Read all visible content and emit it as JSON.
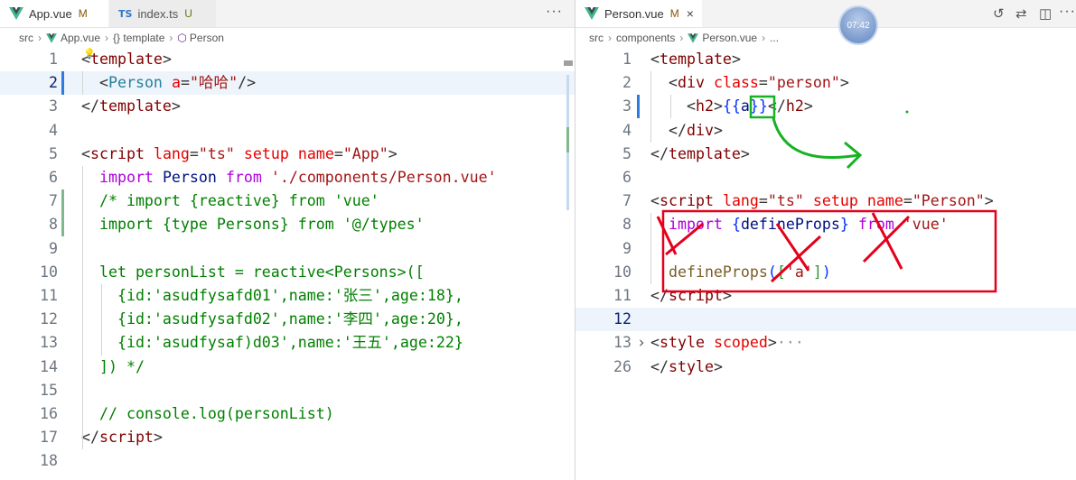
{
  "colors": {
    "accent": "#005fb8",
    "vue_green": "#41b883",
    "annotation_red": "#e4001b",
    "annotation_green": "#17b224"
  },
  "left": {
    "tabs": [
      {
        "label": "App.vue",
        "badge": "M",
        "icon": "vue-icon"
      },
      {
        "label": "index.ts",
        "badge": "U",
        "icon": "ts-icon"
      }
    ],
    "ts_icon_text": "TS",
    "more": "···",
    "breadcrumb": {
      "folder": "src",
      "file": "App.vue",
      "node": "{} template",
      "component": "Person"
    },
    "lines": [
      {
        "n": "1",
        "tokens": [
          [
            "p",
            "<"
          ],
          [
            "t",
            "template"
          ],
          [
            "p",
            ">"
          ]
        ]
      },
      {
        "n": "2",
        "tokens": [
          [
            "p",
            "  <"
          ],
          [
            "ty",
            "Person"
          ],
          [
            "p",
            " "
          ],
          [
            "a",
            "a"
          ],
          [
            "p",
            "="
          ],
          [
            "s",
            "\"哈哈\""
          ],
          [
            "p",
            "/>"
          ]
        ]
      },
      {
        "n": "3",
        "tokens": [
          [
            "p",
            "</"
          ],
          [
            "t",
            "template"
          ],
          [
            "p",
            ">"
          ]
        ]
      },
      {
        "n": "4",
        "tokens": []
      },
      {
        "n": "5",
        "tokens": [
          [
            "p",
            "<"
          ],
          [
            "t",
            "script"
          ],
          [
            "p",
            " "
          ],
          [
            "a",
            "lang"
          ],
          [
            "p",
            "="
          ],
          [
            "s",
            "\"ts\""
          ],
          [
            "p",
            " "
          ],
          [
            "a",
            "setup"
          ],
          [
            "p",
            " "
          ],
          [
            "a",
            "name"
          ],
          [
            "p",
            "="
          ],
          [
            "s",
            "\"App\""
          ],
          [
            "p",
            ">"
          ]
        ]
      },
      {
        "n": "6",
        "tokens": [
          [
            "p",
            "  "
          ],
          [
            "kw",
            "import"
          ],
          [
            "p",
            " "
          ],
          [
            "v",
            "Person"
          ],
          [
            "p",
            " "
          ],
          [
            "kw",
            "from"
          ],
          [
            "p",
            " "
          ],
          [
            "s",
            "'./components/Person.vue'"
          ]
        ]
      },
      {
        "n": "7",
        "tokens": [
          [
            "c",
            "  /* import {reactive} from 'vue'"
          ]
        ]
      },
      {
        "n": "8",
        "tokens": [
          [
            "c",
            "  import {type Persons} from '@/types'"
          ]
        ]
      },
      {
        "n": "9",
        "tokens": []
      },
      {
        "n": "10",
        "tokens": [
          [
            "c",
            "  let personList = reactive<Persons>(["
          ]
        ]
      },
      {
        "n": "11",
        "tokens": [
          [
            "c",
            "    {id:'asudfysafd01',name:'张三',age:18},"
          ]
        ]
      },
      {
        "n": "12",
        "tokens": [
          [
            "c",
            "    {id:'asudfysafd02',name:'李四',age:20},"
          ]
        ]
      },
      {
        "n": "13",
        "tokens": [
          [
            "c",
            "    {id:'asudfysaf)d03',name:'王五',age:22}"
          ]
        ]
      },
      {
        "n": "14",
        "tokens": [
          [
            "c",
            "  ]) */"
          ]
        ]
      },
      {
        "n": "15",
        "tokens": []
      },
      {
        "n": "16",
        "tokens": [
          [
            "c",
            "  // console.log(personList)"
          ]
        ]
      },
      {
        "n": "17",
        "tokens": [
          [
            "p",
            "</"
          ],
          [
            "t",
            "script"
          ],
          [
            "p",
            ">"
          ]
        ]
      },
      {
        "n": "18",
        "tokens": []
      }
    ]
  },
  "right": {
    "tabs": [
      {
        "label": "Person.vue",
        "badge": "M",
        "icon": "vue-icon",
        "close": "×"
      }
    ],
    "timer": "07:42",
    "breadcrumb": {
      "folder": "src",
      "subfolder": "components",
      "file": "Person.vue",
      "rest": "..."
    },
    "lines": [
      {
        "n": "1",
        "tokens": [
          [
            "p",
            "<"
          ],
          [
            "t",
            "template"
          ],
          [
            "p",
            ">"
          ]
        ]
      },
      {
        "n": "2",
        "tokens": [
          [
            "p",
            "  <"
          ],
          [
            "t",
            "div"
          ],
          [
            "p",
            " "
          ],
          [
            "a",
            "class"
          ],
          [
            "p",
            "="
          ],
          [
            "s",
            "\"person\""
          ],
          [
            "p",
            ">"
          ]
        ]
      },
      {
        "n": "3",
        "tokens": [
          [
            "p",
            "    <"
          ],
          [
            "t",
            "h2"
          ],
          [
            "p",
            ">"
          ],
          [
            "br",
            "{{"
          ],
          [
            "v",
            "a"
          ],
          [
            "br",
            "}}"
          ],
          [
            "p",
            "</"
          ],
          [
            "t",
            "h2"
          ],
          [
            "p",
            ">"
          ]
        ]
      },
      {
        "n": "4",
        "tokens": [
          [
            "p",
            "  </"
          ],
          [
            "t",
            "div"
          ],
          [
            "p",
            ">"
          ]
        ]
      },
      {
        "n": "5",
        "tokens": [
          [
            "p",
            "</"
          ],
          [
            "t",
            "template"
          ],
          [
            "p",
            ">"
          ]
        ]
      },
      {
        "n": "6",
        "tokens": []
      },
      {
        "n": "7",
        "tokens": [
          [
            "p",
            "<"
          ],
          [
            "t",
            "script"
          ],
          [
            "p",
            " "
          ],
          [
            "a",
            "lang"
          ],
          [
            "p",
            "="
          ],
          [
            "s",
            "\"ts\""
          ],
          [
            "p",
            " "
          ],
          [
            "a",
            "setup"
          ],
          [
            "p",
            " "
          ],
          [
            "a",
            "name"
          ],
          [
            "p",
            "="
          ],
          [
            "s",
            "\"Person\""
          ],
          [
            "p",
            ">"
          ]
        ]
      },
      {
        "n": "8",
        "tokens": [
          [
            "p",
            "  "
          ],
          [
            "kw",
            "import"
          ],
          [
            "p",
            " "
          ],
          [
            "br",
            "{"
          ],
          [
            "v",
            "defineProps"
          ],
          [
            "br",
            "}"
          ],
          [
            "p",
            " "
          ],
          [
            "kw",
            "from"
          ],
          [
            "p",
            " "
          ],
          [
            "s",
            "'vue'"
          ]
        ]
      },
      {
        "n": "9",
        "tokens": []
      },
      {
        "n": "10",
        "tokens": [
          [
            "p",
            "  "
          ],
          [
            "f",
            "defineProps"
          ],
          [
            "br",
            "("
          ],
          [
            "br2",
            "["
          ],
          [
            "s",
            "'a'"
          ],
          [
            "br2",
            "]"
          ],
          [
            "br",
            ")"
          ]
        ]
      },
      {
        "n": "11",
        "tokens": [
          [
            "p",
            "</"
          ],
          [
            "t",
            "script"
          ],
          [
            "p",
            ">"
          ]
        ]
      },
      {
        "n": "12",
        "tokens": []
      },
      {
        "n": "13",
        "tokens": [
          [
            "p",
            "<"
          ],
          [
            "t",
            "style"
          ],
          [
            "p",
            " "
          ],
          [
            "a",
            "scoped"
          ],
          [
            "p",
            ">"
          ],
          [
            "folded",
            "···"
          ]
        ]
      },
      {
        "n": "26",
        "tokens": [
          [
            "p",
            "</"
          ],
          [
            "t",
            "style"
          ],
          [
            "p",
            ">"
          ]
        ]
      }
    ]
  }
}
